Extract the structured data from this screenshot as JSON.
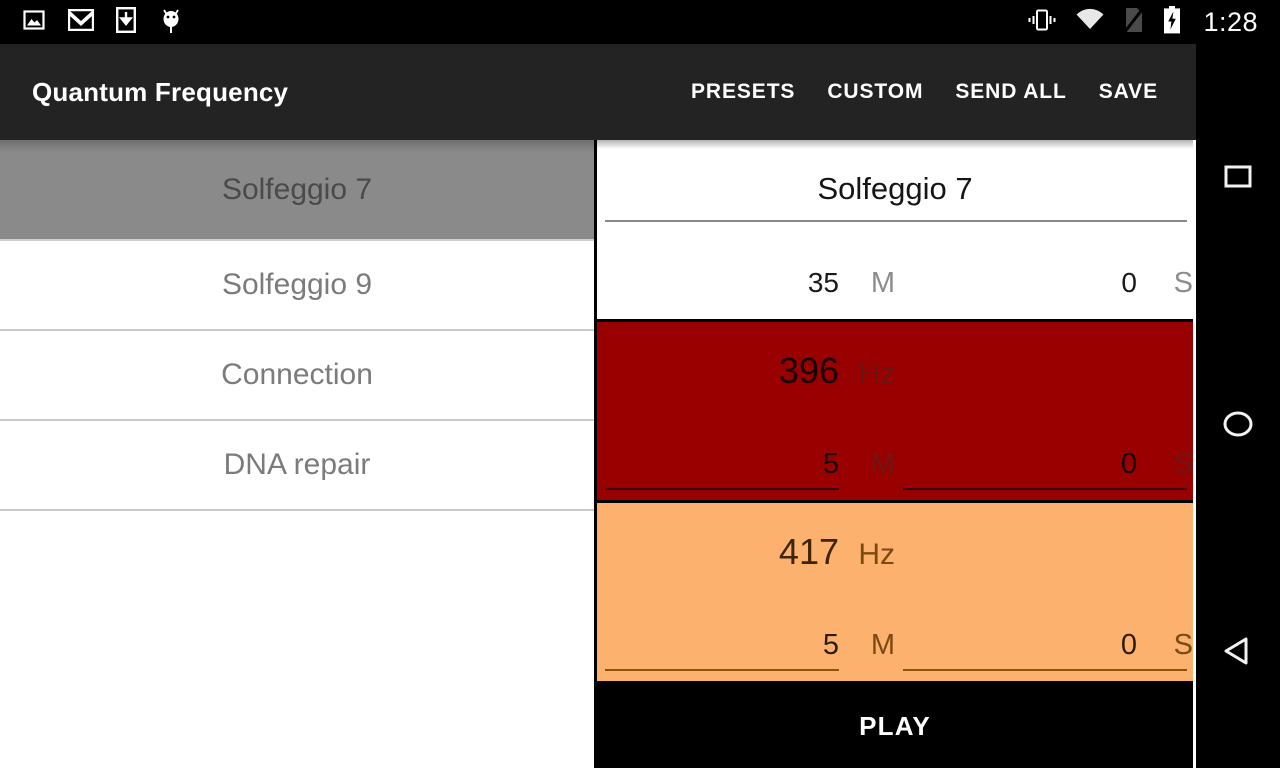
{
  "status_bar": {
    "icons_left": [
      "image-icon",
      "gmail-icon",
      "download-icon",
      "android-bug-icon"
    ],
    "icons_right": [
      "vibrate-icon",
      "wifi-icon",
      "no-sim-icon",
      "battery-charging-icon"
    ],
    "time": "1:28"
  },
  "action_bar": {
    "title": "Quantum Frequency",
    "actions": [
      {
        "label": "PRESETS"
      },
      {
        "label": "CUSTOM"
      },
      {
        "label": "SEND ALL"
      },
      {
        "label": "SAVE"
      }
    ]
  },
  "preset_list": {
    "items": [
      {
        "label": "Solfeggio 7",
        "selected": true
      },
      {
        "label": "Solfeggio 9",
        "selected": false
      },
      {
        "label": "Connection",
        "selected": false
      },
      {
        "label": "DNA repair",
        "selected": false
      }
    ]
  },
  "detail": {
    "preset_name": "Solfeggio 7",
    "total_time": {
      "minutes": "35",
      "minutes_unit": "M",
      "seconds": "0",
      "seconds_unit": "S"
    },
    "tones": [
      {
        "frequency": "396",
        "frequency_unit": "Hz",
        "minutes": "5",
        "minutes_unit": "M",
        "seconds": "0",
        "seconds_unit": "S",
        "color": "#990000"
      },
      {
        "frequency": "417",
        "frequency_unit": "Hz",
        "minutes": "5",
        "minutes_unit": "M",
        "seconds": "0",
        "seconds_unit": "S",
        "color": "#fcb16e"
      }
    ],
    "play_label": "PLAY"
  },
  "nav_bar": {
    "buttons": [
      "recents-icon",
      "home-icon",
      "back-icon"
    ]
  }
}
